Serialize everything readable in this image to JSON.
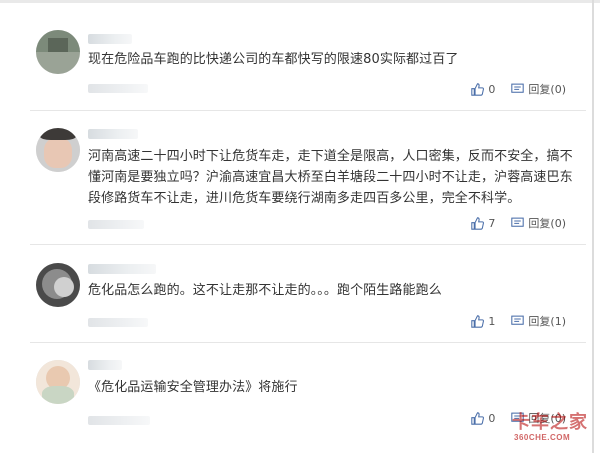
{
  "comments": [
    {
      "text": "现在危险品车跑的比快递公司的车都快写的限速80实际都过百了",
      "likes": "0",
      "reply_label": "回复(0)"
    },
    {
      "text": "河南高速二十四小时下让危货车走，走下道全是限高，人口密集，反而不安全，搞不懂河南是要独立吗？沪渝高速宜昌大桥至白羊塘段二十四小时不让走，沪蓉高速巴东段修路货车不让走，进川危货车要绕行湖南多走四百多公里，完全不科学。",
      "likes": "7",
      "reply_label": "回复(0)"
    },
    {
      "text": "危化品怎么跑的。这不让走那不让走的。。。跑个陌生路能跑么",
      "likes": "1",
      "reply_label": "回复(1)"
    },
    {
      "text": "《危化品运输安全管理办法》将施行",
      "likes": "0",
      "reply_label": "回复(0)"
    }
  ],
  "watermark": {
    "main": "卡车之家",
    "sub": "360CHE.COM"
  },
  "icons": {
    "like": "thumbs-up-icon",
    "reply": "comment-icon"
  },
  "colors": {
    "text": "#333333",
    "icon": "#4a6ea9",
    "watermark": "#b30000"
  }
}
